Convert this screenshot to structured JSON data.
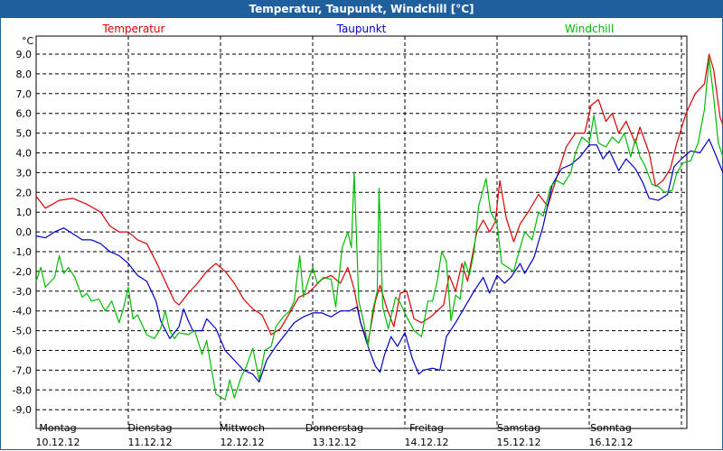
{
  "window": {
    "title": "Temperatur, Taupunkt, Windchill [°C]"
  },
  "chart_data": {
    "type": "line",
    "title": "Temperatur, Taupunkt, Windchill [°C]",
    "ylabel": "°C",
    "ylim": [
      -9.6,
      9.8
    ],
    "yticks": [
      "9,0",
      "8,0",
      "7,0",
      "6,0",
      "5,0",
      "4,0",
      "3,0",
      "2,0",
      "1,0",
      "0,0",
      "-1,0",
      "-2,0",
      "-3,0",
      "-4,0",
      "-5,0",
      "-6,0",
      "-7,0",
      "-8,0",
      "-9,0"
    ],
    "xlim": [
      0,
      7
    ],
    "xticks": [
      {
        "day": "Montag",
        "date": "10.12.12"
      },
      {
        "day": "Dienstag",
        "date": "11.12.12"
      },
      {
        "day": "Mittwoch",
        "date": "12.12.12"
      },
      {
        "day": "Donnerstag",
        "date": "13.12.12"
      },
      {
        "day": "Freitag",
        "date": "14.12.12"
      },
      {
        "day": "Samstag",
        "date": "15.12.12"
      },
      {
        "day": "Sonntag",
        "date": "16.12.12"
      }
    ],
    "grid": true,
    "legend_position": "top",
    "series": [
      {
        "name": "Temperatur",
        "color": "#dd0000",
        "points": [
          [
            0,
            1.8
          ],
          [
            0.1,
            1.2
          ],
          [
            0.25,
            1.6
          ],
          [
            0.4,
            1.7
          ],
          [
            0.55,
            1.4
          ],
          [
            0.7,
            1.0
          ],
          [
            0.8,
            0.3
          ],
          [
            0.9,
            0.0
          ],
          [
            1.0,
            0.0
          ],
          [
            1.1,
            -0.4
          ],
          [
            1.2,
            -0.6
          ],
          [
            1.3,
            -1.5
          ],
          [
            1.4,
            -2.5
          ],
          [
            1.5,
            -3.5
          ],
          [
            1.55,
            -3.7
          ],
          [
            1.65,
            -3.1
          ],
          [
            1.75,
            -2.6
          ],
          [
            1.85,
            -2.0
          ],
          [
            1.95,
            -1.6
          ],
          [
            2.05,
            -2.0
          ],
          [
            2.15,
            -2.6
          ],
          [
            2.25,
            -3.4
          ],
          [
            2.35,
            -3.9
          ],
          [
            2.45,
            -4.2
          ],
          [
            2.55,
            -5.2
          ],
          [
            2.65,
            -4.9
          ],
          [
            2.75,
            -4.1
          ],
          [
            2.85,
            -3.3
          ],
          [
            2.95,
            -3.1
          ],
          [
            3.1,
            -2.4
          ],
          [
            3.2,
            -2.2
          ],
          [
            3.3,
            -2.6
          ],
          [
            3.38,
            -1.8
          ],
          [
            3.45,
            -2.9
          ],
          [
            3.52,
            -4.6
          ],
          [
            3.6,
            -5.6
          ],
          [
            3.68,
            -3.5
          ],
          [
            3.73,
            -2.7
          ],
          [
            3.8,
            -3.8
          ],
          [
            3.88,
            -4.8
          ],
          [
            3.95,
            -3.1
          ],
          [
            4.02,
            -3.0
          ],
          [
            4.1,
            -4.4
          ],
          [
            4.18,
            -4.6
          ],
          [
            4.28,
            -4.3
          ],
          [
            4.35,
            -4.0
          ],
          [
            4.42,
            -3.7
          ],
          [
            4.48,
            -2.2
          ],
          [
            4.55,
            -3.0
          ],
          [
            4.62,
            -1.6
          ],
          [
            4.68,
            -2.5
          ],
          [
            4.72,
            -1.5
          ],
          [
            4.78,
            0.0
          ],
          [
            4.85,
            0.6
          ],
          [
            4.92,
            0.0
          ],
          [
            4.98,
            0.5
          ],
          [
            5.03,
            2.6
          ],
          [
            5.1,
            0.7
          ],
          [
            5.18,
            -0.5
          ],
          [
            5.25,
            0.4
          ],
          [
            5.35,
            1.1
          ],
          [
            5.45,
            1.9
          ],
          [
            5.55,
            1.3
          ],
          [
            5.65,
            2.8
          ],
          [
            5.75,
            4.3
          ],
          [
            5.85,
            5.0
          ],
          [
            5.95,
            5.0
          ],
          [
            6.02,
            6.4
          ],
          [
            6.1,
            6.7
          ],
          [
            6.18,
            5.6
          ],
          [
            6.25,
            6.0
          ],
          [
            6.32,
            5.0
          ],
          [
            6.4,
            5.6
          ],
          [
            6.5,
            4.5
          ],
          [
            6.55,
            5.3
          ],
          [
            6.65,
            4.0
          ],
          [
            6.72,
            2.3
          ],
          [
            6.8,
            2.6
          ],
          [
            6.88,
            3.2
          ],
          [
            6.95,
            4.5
          ],
          [
            7.05,
            6.0
          ],
          [
            7.15,
            7.0
          ],
          [
            7.25,
            7.5
          ],
          [
            7.3,
            9.0
          ],
          [
            7.35,
            8.2
          ],
          [
            7.42,
            5.8
          ],
          [
            7.5,
            4.8
          ],
          [
            7.6,
            5.0
          ],
          [
            7.68,
            4.6
          ],
          [
            7.72,
            4.0
          ]
        ]
      },
      {
        "name": "Taupunkt",
        "color": "#0000cc",
        "points": [
          [
            0,
            -0.2
          ],
          [
            0.1,
            -0.3
          ],
          [
            0.2,
            0.0
          ],
          [
            0.3,
            0.2
          ],
          [
            0.4,
            -0.1
          ],
          [
            0.5,
            -0.4
          ],
          [
            0.6,
            -0.4
          ],
          [
            0.7,
            -0.6
          ],
          [
            0.8,
            -1.0
          ],
          [
            0.9,
            -1.2
          ],
          [
            1.0,
            -1.6
          ],
          [
            1.1,
            -2.2
          ],
          [
            1.2,
            -2.5
          ],
          [
            1.3,
            -3.5
          ],
          [
            1.35,
            -4.5
          ],
          [
            1.45,
            -5.4
          ],
          [
            1.55,
            -4.8
          ],
          [
            1.6,
            -3.9
          ],
          [
            1.65,
            -4.5
          ],
          [
            1.7,
            -5.0
          ],
          [
            1.8,
            -5.0
          ],
          [
            1.85,
            -4.4
          ],
          [
            1.95,
            -4.9
          ],
          [
            2.05,
            -6.0
          ],
          [
            2.15,
            -6.5
          ],
          [
            2.25,
            -7.0
          ],
          [
            2.35,
            -7.2
          ],
          [
            2.42,
            -7.6
          ],
          [
            2.5,
            -6.5
          ],
          [
            2.6,
            -5.8
          ],
          [
            2.7,
            -5.2
          ],
          [
            2.8,
            -4.6
          ],
          [
            2.9,
            -4.3
          ],
          [
            3.0,
            -4.1
          ],
          [
            3.1,
            -4.1
          ],
          [
            3.2,
            -4.3
          ],
          [
            3.3,
            -4.0
          ],
          [
            3.4,
            -4.0
          ],
          [
            3.48,
            -3.8
          ],
          [
            3.52,
            -4.6
          ],
          [
            3.6,
            -5.8
          ],
          [
            3.68,
            -6.8
          ],
          [
            3.73,
            -7.1
          ],
          [
            3.78,
            -6.2
          ],
          [
            3.85,
            -5.3
          ],
          [
            3.92,
            -5.8
          ],
          [
            4.0,
            -5.1
          ],
          [
            4.08,
            -6.4
          ],
          [
            4.15,
            -7.2
          ],
          [
            4.2,
            -7.0
          ],
          [
            4.3,
            -6.9
          ],
          [
            4.38,
            -7.0
          ],
          [
            4.45,
            -5.3
          ],
          [
            4.55,
            -4.6
          ],
          [
            4.65,
            -3.8
          ],
          [
            4.75,
            -3.0
          ],
          [
            4.85,
            -2.3
          ],
          [
            4.92,
            -3.1
          ],
          [
            5.0,
            -2.2
          ],
          [
            5.08,
            -2.6
          ],
          [
            5.15,
            -2.3
          ],
          [
            5.25,
            -1.6
          ],
          [
            5.3,
            -2.1
          ],
          [
            5.4,
            -1.3
          ],
          [
            5.5,
            0.3
          ],
          [
            5.6,
            2.4
          ],
          [
            5.7,
            3.2
          ],
          [
            5.8,
            3.4
          ],
          [
            5.9,
            3.8
          ],
          [
            6.0,
            4.4
          ],
          [
            6.08,
            4.4
          ],
          [
            6.15,
            3.7
          ],
          [
            6.22,
            4.1
          ],
          [
            6.32,
            3.1
          ],
          [
            6.4,
            3.7
          ],
          [
            6.5,
            3.2
          ],
          [
            6.58,
            2.5
          ],
          [
            6.65,
            1.7
          ],
          [
            6.75,
            1.6
          ],
          [
            6.85,
            1.9
          ],
          [
            6.92,
            3.3
          ],
          [
            7.0,
            3.7
          ],
          [
            7.1,
            4.1
          ],
          [
            7.2,
            4.0
          ],
          [
            7.3,
            4.7
          ],
          [
            7.38,
            3.8
          ],
          [
            7.45,
            3.0
          ],
          [
            7.55,
            3.1
          ],
          [
            7.62,
            3.3
          ],
          [
            7.72,
            3.0
          ]
        ]
      },
      {
        "name": "Windchill",
        "color": "#00bb00",
        "points": [
          [
            0,
            -2.5
          ],
          [
            0.05,
            -1.8
          ],
          [
            0.1,
            -2.8
          ],
          [
            0.2,
            -2.3
          ],
          [
            0.25,
            -1.2
          ],
          [
            0.3,
            -2.1
          ],
          [
            0.35,
            -1.8
          ],
          [
            0.42,
            -2.3
          ],
          [
            0.5,
            -3.3
          ],
          [
            0.55,
            -3.1
          ],
          [
            0.6,
            -3.5
          ],
          [
            0.68,
            -3.4
          ],
          [
            0.75,
            -4.0
          ],
          [
            0.82,
            -3.5
          ],
          [
            0.9,
            -4.6
          ],
          [
            0.95,
            -3.8
          ],
          [
            1.0,
            -2.8
          ],
          [
            1.05,
            -4.4
          ],
          [
            1.1,
            -4.2
          ],
          [
            1.2,
            -5.2
          ],
          [
            1.28,
            -5.4
          ],
          [
            1.35,
            -4.9
          ],
          [
            1.4,
            -4.0
          ],
          [
            1.45,
            -5.0
          ],
          [
            1.5,
            -5.4
          ],
          [
            1.55,
            -5.1
          ],
          [
            1.65,
            -5.2
          ],
          [
            1.72,
            -5.0
          ],
          [
            1.8,
            -6.2
          ],
          [
            1.85,
            -5.5
          ],
          [
            1.9,
            -6.9
          ],
          [
            1.95,
            -8.2
          ],
          [
            2.05,
            -8.5
          ],
          [
            2.1,
            -7.5
          ],
          [
            2.15,
            -8.4
          ],
          [
            2.22,
            -7.4
          ],
          [
            2.28,
            -6.8
          ],
          [
            2.35,
            -5.9
          ],
          [
            2.42,
            -7.5
          ],
          [
            2.48,
            -6.0
          ],
          [
            2.55,
            -5.8
          ],
          [
            2.6,
            -4.8
          ],
          [
            2.68,
            -4.3
          ],
          [
            2.75,
            -4.0
          ],
          [
            2.8,
            -3.5
          ],
          [
            2.86,
            -1.2
          ],
          [
            2.9,
            -3.3
          ],
          [
            2.95,
            -2.5
          ],
          [
            3.0,
            -1.8
          ],
          [
            3.05,
            -2.6
          ],
          [
            3.12,
            -2.3
          ],
          [
            3.2,
            -2.4
          ],
          [
            3.25,
            -3.8
          ],
          [
            3.32,
            -0.8
          ],
          [
            3.38,
            0.0
          ],
          [
            3.42,
            -0.8
          ],
          [
            3.45,
            3.0
          ],
          [
            3.5,
            -3.5
          ],
          [
            3.55,
            -4.5
          ],
          [
            3.6,
            -5.8
          ],
          [
            3.65,
            -4.0
          ],
          [
            3.7,
            -3.0
          ],
          [
            3.72,
            2.2
          ],
          [
            3.76,
            -3.8
          ],
          [
            3.82,
            -4.9
          ],
          [
            3.9,
            -3.3
          ],
          [
            3.95,
            -3.6
          ],
          [
            4.02,
            -4.3
          ],
          [
            4.1,
            -5.0
          ],
          [
            4.18,
            -5.3
          ],
          [
            4.25,
            -3.5
          ],
          [
            4.3,
            -3.5
          ],
          [
            4.35,
            -2.5
          ],
          [
            4.4,
            -1.0
          ],
          [
            4.45,
            -1.5
          ],
          [
            4.5,
            -4.5
          ],
          [
            4.55,
            -3.2
          ],
          [
            4.6,
            -3.4
          ],
          [
            4.65,
            -1.5
          ],
          [
            4.7,
            -2.2
          ],
          [
            4.75,
            -1.0
          ],
          [
            4.8,
            1.3
          ],
          [
            4.88,
            2.7
          ],
          [
            4.93,
            1.0
          ],
          [
            5.0,
            0.4
          ],
          [
            5.05,
            -1.6
          ],
          [
            5.12,
            -1.8
          ],
          [
            5.18,
            -2.0
          ],
          [
            5.22,
            -1.3
          ],
          [
            5.3,
            0.0
          ],
          [
            5.38,
            -0.4
          ],
          [
            5.45,
            1.0
          ],
          [
            5.5,
            0.8
          ],
          [
            5.58,
            2.3
          ],
          [
            5.65,
            2.6
          ],
          [
            5.72,
            2.4
          ],
          [
            5.8,
            3.0
          ],
          [
            5.85,
            4.0
          ],
          [
            5.92,
            4.8
          ],
          [
            6.0,
            4.5
          ],
          [
            6.05,
            5.9
          ],
          [
            6.1,
            4.5
          ],
          [
            6.18,
            4.3
          ],
          [
            6.25,
            4.8
          ],
          [
            6.32,
            4.5
          ],
          [
            6.38,
            5.0
          ],
          [
            6.45,
            3.8
          ],
          [
            6.5,
            4.7
          ],
          [
            6.55,
            3.8
          ],
          [
            6.6,
            3.4
          ],
          [
            6.68,
            2.4
          ],
          [
            6.75,
            2.3
          ],
          [
            6.82,
            2.0
          ],
          [
            6.9,
            2.1
          ],
          [
            6.95,
            3.0
          ],
          [
            7.02,
            3.5
          ],
          [
            7.1,
            3.6
          ],
          [
            7.18,
            4.5
          ],
          [
            7.25,
            6.2
          ],
          [
            7.3,
            8.8
          ],
          [
            7.35,
            6.8
          ],
          [
            7.4,
            4.5
          ],
          [
            7.45,
            3.8
          ],
          [
            7.52,
            3.7
          ],
          [
            7.58,
            4.6
          ],
          [
            7.65,
            4.5
          ],
          [
            7.72,
            4.0
          ]
        ]
      }
    ]
  }
}
